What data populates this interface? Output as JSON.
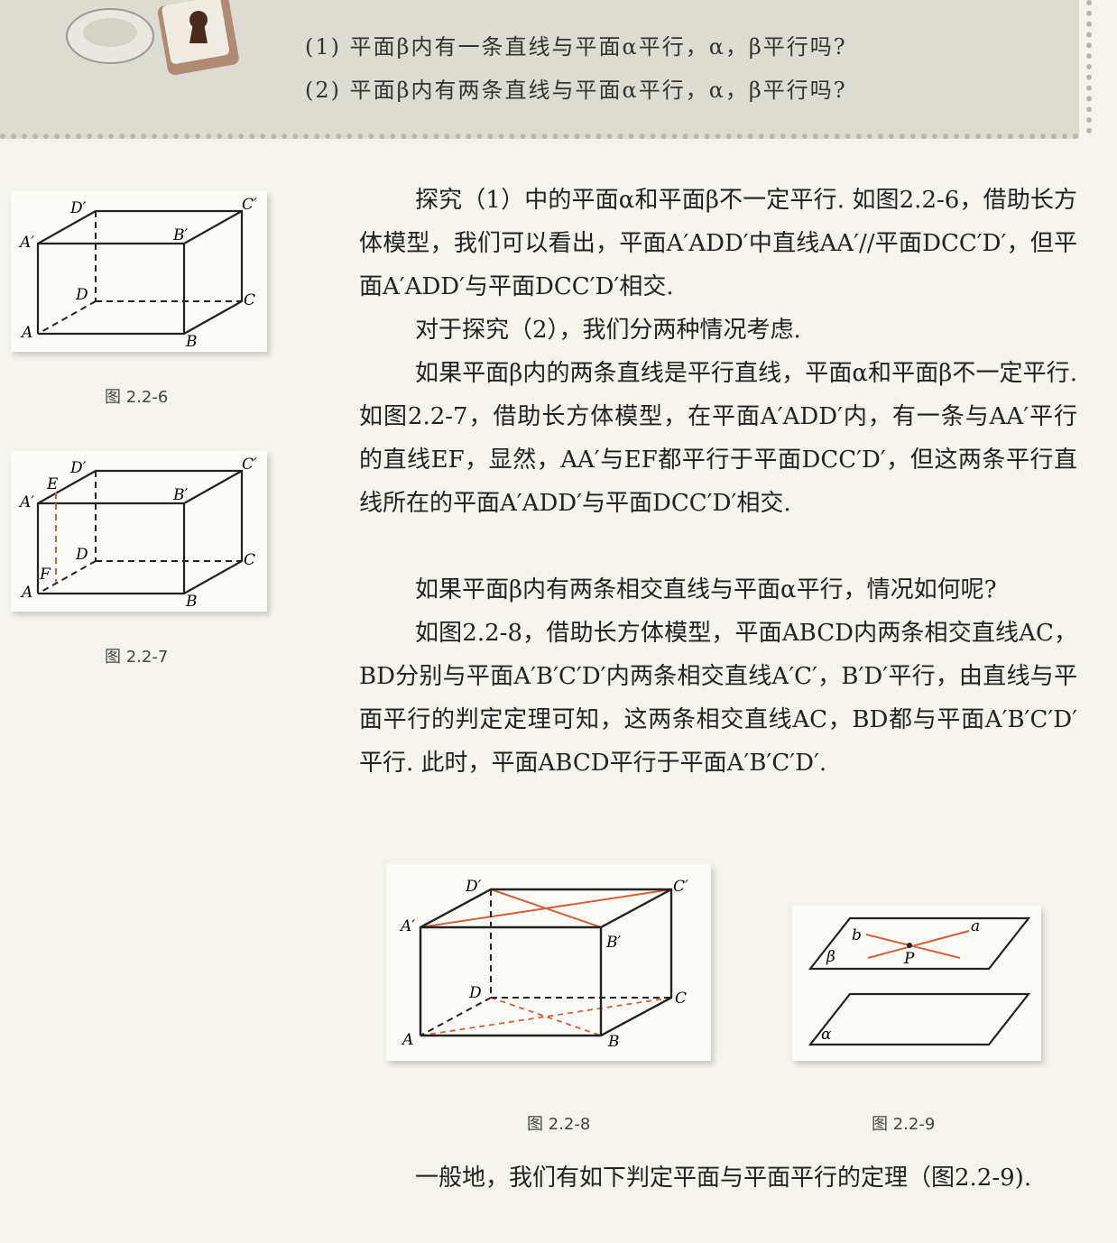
{
  "header": {
    "questions": [
      "(1) 平面β内有一条直线与平面α平行，α，β平行吗?",
      "(2) 平面β内有两条直线与平面α平行，α，β平行吗?"
    ]
  },
  "paragraphs": [
    "探究（1）中的平面α和平面β不一定平行. 如图2.2-6，借助长方体模型，我们可以看出，平面A′ADD′中直线AA′//平面DCC′D′，但平面A′ADD′与平面DCC′D′相交.",
    "对于探究（2），我们分两种情况考虑.",
    "如果平面β内的两条直线是平行直线，平面α和平面β不一定平行. 如图2.2-7，借助长方体模型，在平面A′ADD′内，有一条与AA′平行的直线EF，显然，AA′与EF都平行于平面DCC′D′，但这两条平行直线所在的平面A′ADD′与平面DCC′D′相交.",
    "如果平面β内有两条相交直线与平面α平行，情况如何呢?",
    "如图2.2-8，借助长方体模型，平面ABCD内两条相交直线AC，BD分别与平面A′B′C′D′内两条相交直线A′C′，B′D′平行，由直线与平面平行的判定定理可知，这两条相交直线AC，BD都与平面A′B′C′D′平行. 此时，平面ABCD平行于平面A′B′C′D′.",
    "一般地，我们有如下判定平面与平面平行的定理（图2.2-9)."
  ],
  "figures": {
    "fig226": {
      "caption": "图 2.2-6",
      "labels": {
        "A": "A",
        "B": "B",
        "C": "C",
        "D": "D",
        "A1": "A′",
        "B1": "B′",
        "C1": "C′",
        "D1": "D′"
      }
    },
    "fig227": {
      "caption": "图 2.2-7",
      "labels": {
        "A": "A",
        "B": "B",
        "C": "C",
        "D": "D",
        "A1": "A′",
        "B1": "B′",
        "C1": "C′",
        "D1": "D′",
        "E": "E",
        "F": "F"
      }
    },
    "fig228": {
      "caption": "图 2.2-8",
      "labels": {
        "A": "A",
        "B": "B",
        "C": "C",
        "D": "D",
        "A1": "A′",
        "B1": "B′",
        "C1": "C′",
        "D1": "D′"
      }
    },
    "fig229": {
      "caption": "图 2.2-9",
      "labels": {
        "a": "a",
        "b": "b",
        "P": "P",
        "beta": "β",
        "alpha": "α"
      }
    }
  },
  "colors": {
    "accent_line": "#d2603a",
    "band": "#dcdcd3"
  }
}
